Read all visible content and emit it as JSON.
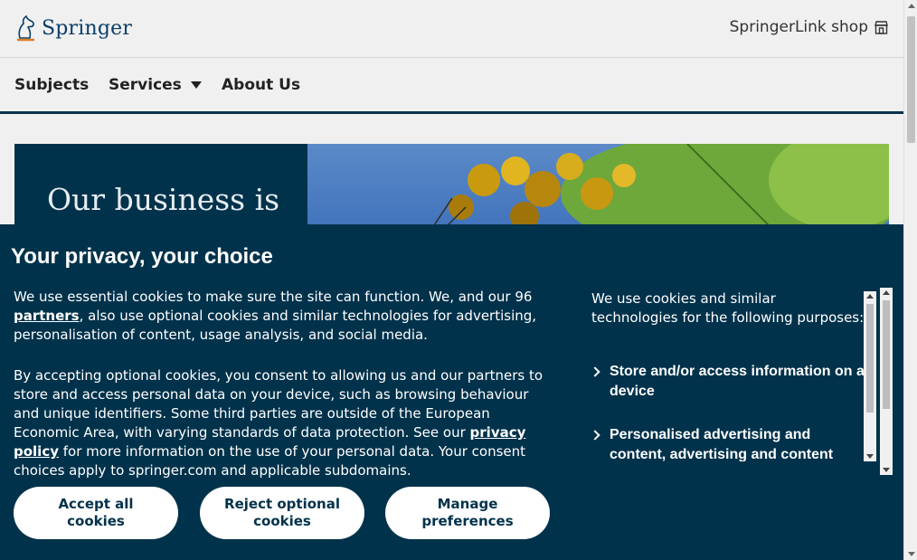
{
  "header": {
    "logo_text": "Springer",
    "shop_label": "SpringerLink shop"
  },
  "nav": {
    "items": [
      {
        "label": "Subjects"
      },
      {
        "label": "Services"
      },
      {
        "label": "About Us"
      }
    ]
  },
  "hero": {
    "title": "Our business is"
  },
  "cookie": {
    "title": "Your privacy, your choice",
    "para1_before": "We use essential cookies to make sure the site can function. We, and our 96",
    "para1_link": "partners",
    "para1_after": ", also use optional cookies and similar technologies for advertising, personalisation of content, usage analysis, and social media.",
    "para2_before": "By accepting optional cookies, you consent to allowing us and our partners to store and access personal data on your device, such as browsing behaviour and unique identifiers. Some third parties are outside of the European Economic Area, with varying standards of data protection. See our",
    "para2_link": "privacy policy",
    "para2_after": "for more information on the use of your personal data. Your consent choices apply to springer.com and applicable subdomains.",
    "purposes_intro": "We use cookies and similar technologies for the following purposes:",
    "purposes": [
      {
        "label": "Store and/or access information on a device"
      },
      {
        "label": "Personalised advertising and content, advertising and content measurement, audience research and services development"
      }
    ],
    "buttons": {
      "accept": "Accept all cookies",
      "reject": "Reject optional cookies",
      "manage": "Manage preferences"
    }
  },
  "colors": {
    "banner_bg": "#01324b",
    "page_bg": "#f0f0f0",
    "brand": "#0b3e6a"
  }
}
